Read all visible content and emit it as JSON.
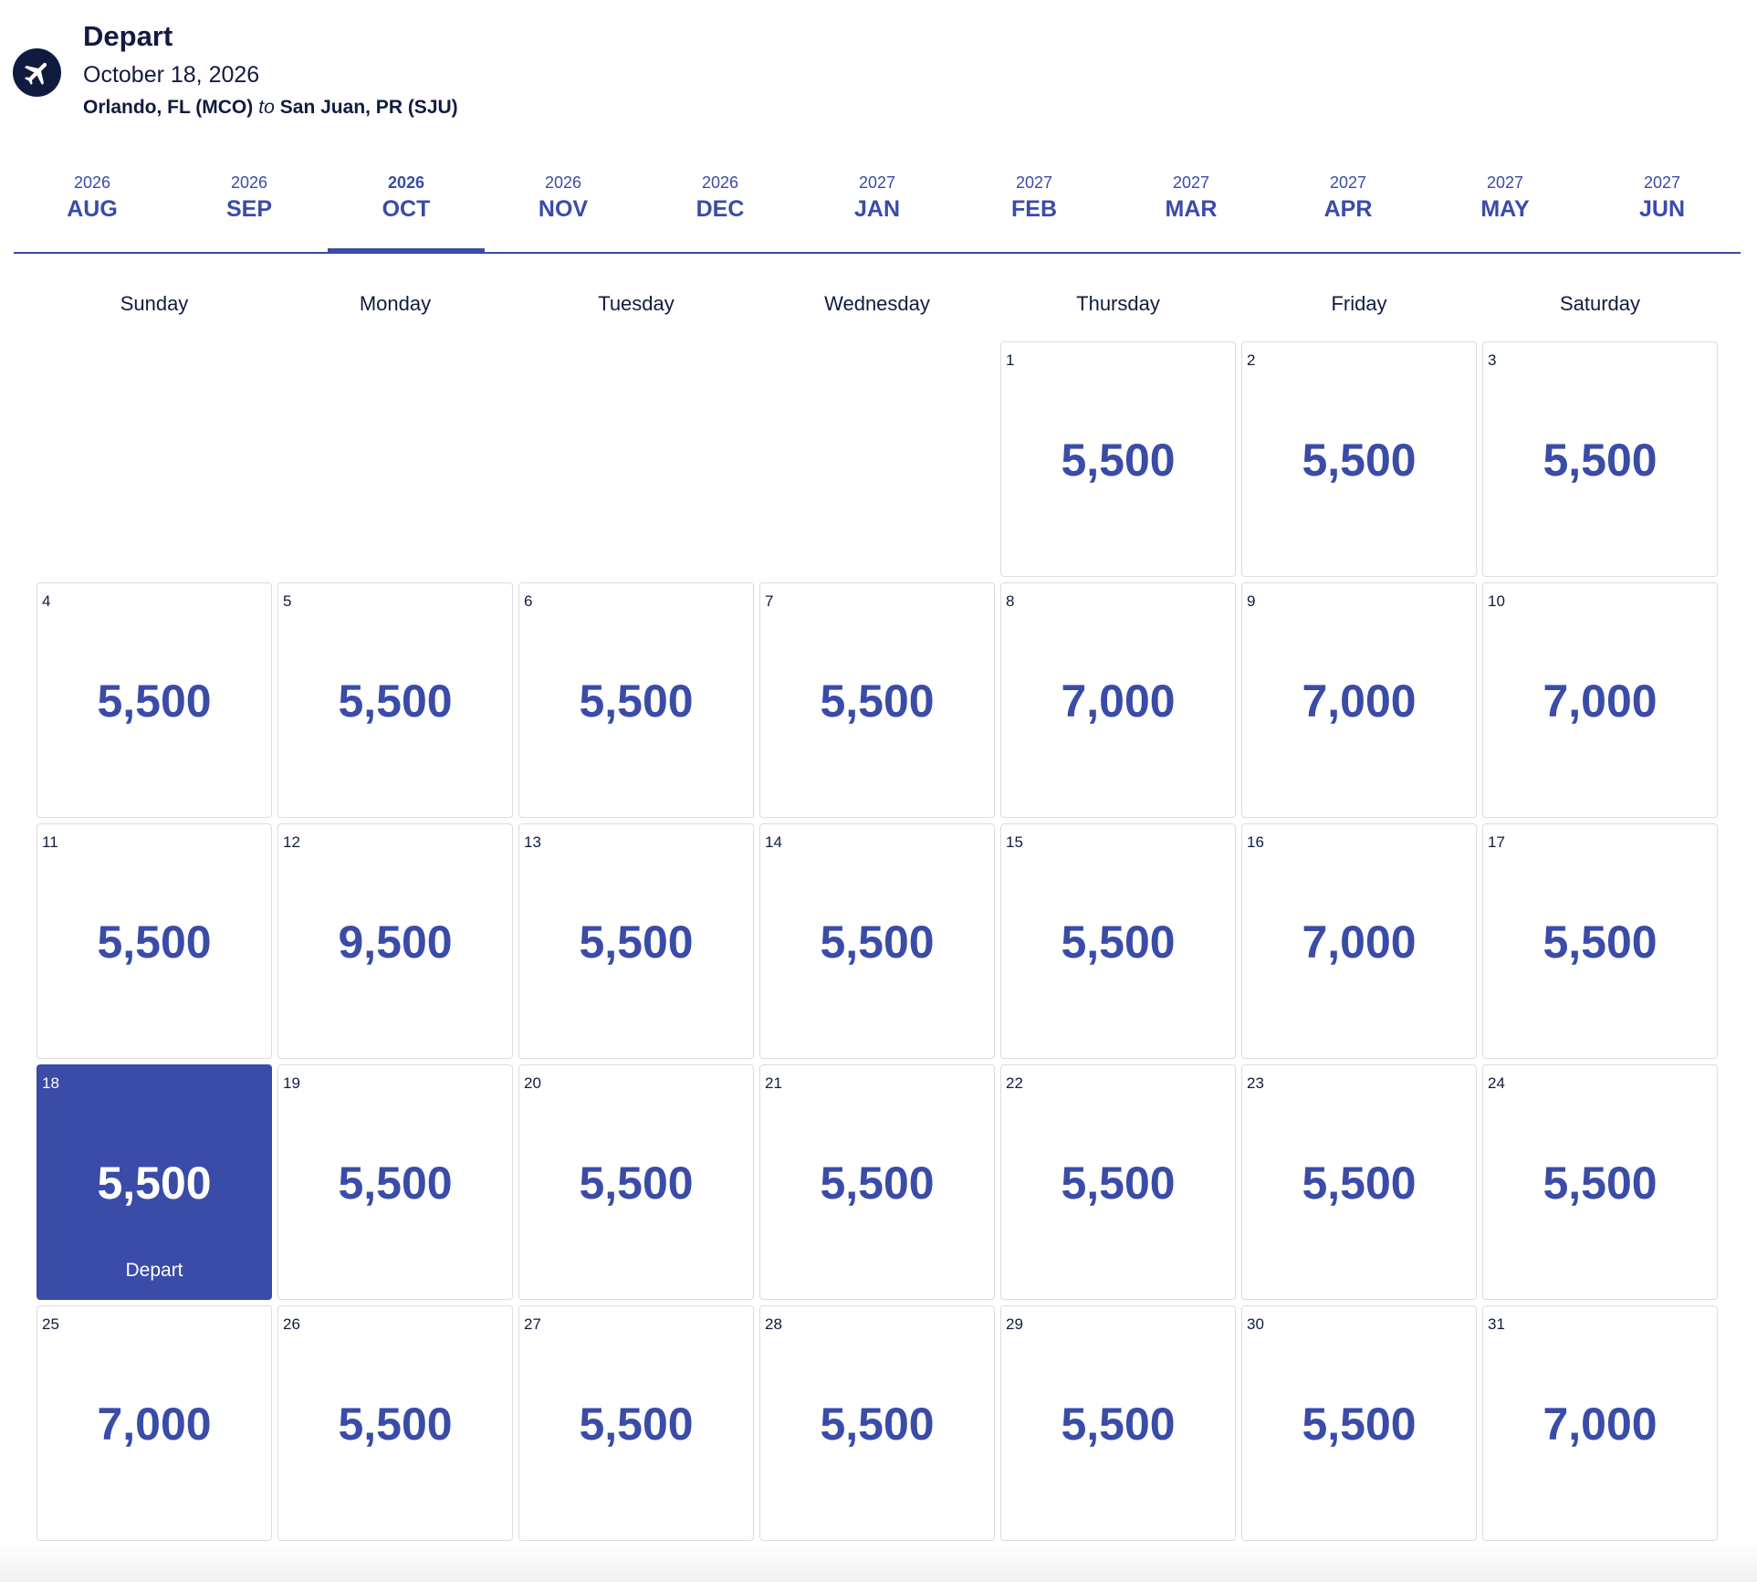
{
  "header": {
    "title": "Depart",
    "date": "October 18, 2026",
    "origin": "Orlando, FL (MCO)",
    "to": "to",
    "destination": "San Juan, PR (SJU)",
    "icon": "airplane-icon"
  },
  "months": [
    {
      "year": "2026",
      "month": "AUG",
      "active": false
    },
    {
      "year": "2026",
      "month": "SEP",
      "active": false
    },
    {
      "year": "2026",
      "month": "OCT",
      "active": true
    },
    {
      "year": "2026",
      "month": "NOV",
      "active": false
    },
    {
      "year": "2026",
      "month": "DEC",
      "active": false
    },
    {
      "year": "2027",
      "month": "JAN",
      "active": false
    },
    {
      "year": "2027",
      "month": "FEB",
      "active": false
    },
    {
      "year": "2027",
      "month": "MAR",
      "active": false
    },
    {
      "year": "2027",
      "month": "APR",
      "active": false
    },
    {
      "year": "2027",
      "month": "MAY",
      "active": false
    },
    {
      "year": "2027",
      "month": "JUN",
      "active": false
    }
  ],
  "weekdays": [
    "Sunday",
    "Monday",
    "Tuesday",
    "Wednesday",
    "Thursday",
    "Friday",
    "Saturday"
  ],
  "calendar": {
    "leading_empty": 4,
    "selected_day": "18",
    "selected_label": "Depart",
    "days": [
      {
        "day": "1",
        "price": "5,500"
      },
      {
        "day": "2",
        "price": "5,500"
      },
      {
        "day": "3",
        "price": "5,500"
      },
      {
        "day": "4",
        "price": "5,500"
      },
      {
        "day": "5",
        "price": "5,500"
      },
      {
        "day": "6",
        "price": "5,500"
      },
      {
        "day": "7",
        "price": "5,500"
      },
      {
        "day": "8",
        "price": "7,000"
      },
      {
        "day": "9",
        "price": "7,000"
      },
      {
        "day": "10",
        "price": "7,000"
      },
      {
        "day": "11",
        "price": "5,500"
      },
      {
        "day": "12",
        "price": "9,500"
      },
      {
        "day": "13",
        "price": "5,500"
      },
      {
        "day": "14",
        "price": "5,500"
      },
      {
        "day": "15",
        "price": "5,500"
      },
      {
        "day": "16",
        "price": "7,000"
      },
      {
        "day": "17",
        "price": "5,500"
      },
      {
        "day": "18",
        "price": "5,500"
      },
      {
        "day": "19",
        "price": "5,500"
      },
      {
        "day": "20",
        "price": "5,500"
      },
      {
        "day": "21",
        "price": "5,500"
      },
      {
        "day": "22",
        "price": "5,500"
      },
      {
        "day": "23",
        "price": "5,500"
      },
      {
        "day": "24",
        "price": "5,500"
      },
      {
        "day": "25",
        "price": "7,000"
      },
      {
        "day": "26",
        "price": "5,500"
      },
      {
        "day": "27",
        "price": "5,500"
      },
      {
        "day": "28",
        "price": "5,500"
      },
      {
        "day": "29",
        "price": "5,500"
      },
      {
        "day": "30",
        "price": "5,500"
      },
      {
        "day": "31",
        "price": "7,000"
      }
    ]
  },
  "colors": {
    "accent": "#3a4ba8",
    "navy": "#111b40"
  }
}
